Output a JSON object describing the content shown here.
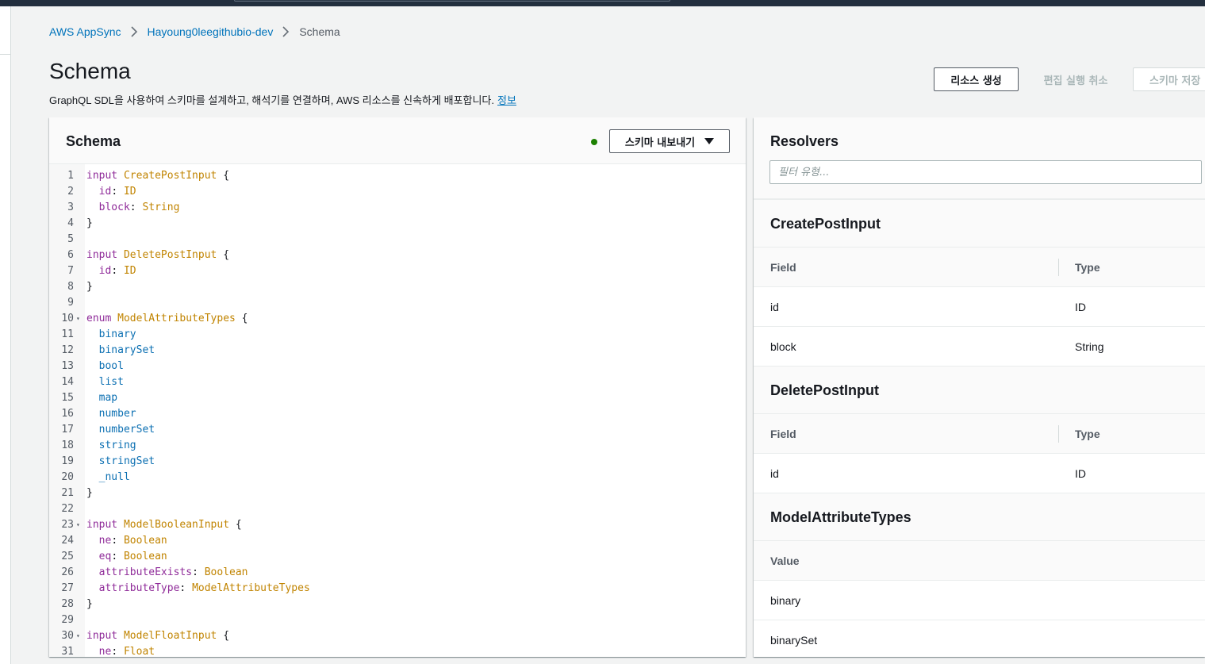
{
  "breadcrumb": {
    "items": [
      "AWS AppSync",
      "Hayoung0leegithubio-dev"
    ],
    "current": "Schema"
  },
  "page": {
    "title": "Schema",
    "description": "GraphQL SDL을 사용하여 스키마를 설계하고, 해석기를 연결하며, AWS 리소스를 신속하게 배포합니다.",
    "info_link": "정보"
  },
  "actions": {
    "create_resources": "리소스 생성",
    "cancel_edit": "편집 실행 취소",
    "save_schema": "스키마 저장"
  },
  "schema_panel": {
    "title": "Schema",
    "export_label": "스키마 내보내기",
    "status_color": "#1d8102",
    "lines": [
      {
        "n": "1",
        "fold": false,
        "tokens": [
          [
            "kw",
            "input"
          ],
          [
            "pn",
            " "
          ],
          [
            "tp",
            "CreatePostInput"
          ],
          [
            "pn",
            " {"
          ]
        ]
      },
      {
        "n": "2",
        "fold": false,
        "tokens": [
          [
            "pn",
            "  "
          ],
          [
            "fd",
            "id"
          ],
          [
            "pn",
            ": "
          ],
          [
            "tp",
            "ID"
          ]
        ]
      },
      {
        "n": "3",
        "fold": false,
        "tokens": [
          [
            "pn",
            "  "
          ],
          [
            "fd",
            "block"
          ],
          [
            "pn",
            ": "
          ],
          [
            "tp",
            "String"
          ]
        ]
      },
      {
        "n": "4",
        "fold": false,
        "tokens": [
          [
            "pn",
            "}"
          ]
        ]
      },
      {
        "n": "5",
        "fold": false,
        "tokens": []
      },
      {
        "n": "6",
        "fold": false,
        "tokens": [
          [
            "kw",
            "input"
          ],
          [
            "pn",
            " "
          ],
          [
            "tp",
            "DeletePostInput"
          ],
          [
            "pn",
            " {"
          ]
        ]
      },
      {
        "n": "7",
        "fold": false,
        "tokens": [
          [
            "pn",
            "  "
          ],
          [
            "fd",
            "id"
          ],
          [
            "pn",
            ": "
          ],
          [
            "tp",
            "ID"
          ]
        ]
      },
      {
        "n": "8",
        "fold": false,
        "tokens": [
          [
            "pn",
            "}"
          ]
        ]
      },
      {
        "n": "9",
        "fold": false,
        "tokens": []
      },
      {
        "n": "10",
        "fold": true,
        "tokens": [
          [
            "kw",
            "enum"
          ],
          [
            "pn",
            " "
          ],
          [
            "tp",
            "ModelAttributeTypes"
          ],
          [
            "pn",
            " {"
          ]
        ]
      },
      {
        "n": "11",
        "fold": false,
        "tokens": [
          [
            "pn",
            "  "
          ],
          [
            "ev",
            "binary"
          ]
        ]
      },
      {
        "n": "12",
        "fold": false,
        "tokens": [
          [
            "pn",
            "  "
          ],
          [
            "ev",
            "binarySet"
          ]
        ]
      },
      {
        "n": "13",
        "fold": false,
        "tokens": [
          [
            "pn",
            "  "
          ],
          [
            "ev",
            "bool"
          ]
        ]
      },
      {
        "n": "14",
        "fold": false,
        "tokens": [
          [
            "pn",
            "  "
          ],
          [
            "ev",
            "list"
          ]
        ]
      },
      {
        "n": "15",
        "fold": false,
        "tokens": [
          [
            "pn",
            "  "
          ],
          [
            "ev",
            "map"
          ]
        ]
      },
      {
        "n": "16",
        "fold": false,
        "tokens": [
          [
            "pn",
            "  "
          ],
          [
            "ev",
            "number"
          ]
        ]
      },
      {
        "n": "17",
        "fold": false,
        "tokens": [
          [
            "pn",
            "  "
          ],
          [
            "ev",
            "numberSet"
          ]
        ]
      },
      {
        "n": "18",
        "fold": false,
        "tokens": [
          [
            "pn",
            "  "
          ],
          [
            "ev",
            "string"
          ]
        ]
      },
      {
        "n": "19",
        "fold": false,
        "tokens": [
          [
            "pn",
            "  "
          ],
          [
            "ev",
            "stringSet"
          ]
        ]
      },
      {
        "n": "20",
        "fold": false,
        "tokens": [
          [
            "pn",
            "  "
          ],
          [
            "ev",
            "_null"
          ]
        ]
      },
      {
        "n": "21",
        "fold": false,
        "tokens": [
          [
            "pn",
            "}"
          ]
        ]
      },
      {
        "n": "22",
        "fold": false,
        "tokens": []
      },
      {
        "n": "23",
        "fold": true,
        "tokens": [
          [
            "kw",
            "input"
          ],
          [
            "pn",
            " "
          ],
          [
            "tp",
            "ModelBooleanInput"
          ],
          [
            "pn",
            " {"
          ]
        ]
      },
      {
        "n": "24",
        "fold": false,
        "tokens": [
          [
            "pn",
            "  "
          ],
          [
            "fd",
            "ne"
          ],
          [
            "pn",
            ": "
          ],
          [
            "tp",
            "Boolean"
          ]
        ]
      },
      {
        "n": "25",
        "fold": false,
        "tokens": [
          [
            "pn",
            "  "
          ],
          [
            "fd",
            "eq"
          ],
          [
            "pn",
            ": "
          ],
          [
            "tp",
            "Boolean"
          ]
        ]
      },
      {
        "n": "26",
        "fold": false,
        "tokens": [
          [
            "pn",
            "  "
          ],
          [
            "fd",
            "attributeExists"
          ],
          [
            "pn",
            ": "
          ],
          [
            "tp",
            "Boolean"
          ]
        ]
      },
      {
        "n": "27",
        "fold": false,
        "tokens": [
          [
            "pn",
            "  "
          ],
          [
            "fd",
            "attributeType"
          ],
          [
            "pn",
            ": "
          ],
          [
            "tp",
            "ModelAttributeTypes"
          ]
        ]
      },
      {
        "n": "28",
        "fold": false,
        "tokens": [
          [
            "pn",
            "}"
          ]
        ]
      },
      {
        "n": "29",
        "fold": false,
        "tokens": []
      },
      {
        "n": "30",
        "fold": true,
        "tokens": [
          [
            "kw",
            "input"
          ],
          [
            "pn",
            " "
          ],
          [
            "tp",
            "ModelFloatInput"
          ],
          [
            "pn",
            " {"
          ]
        ]
      },
      {
        "n": "31",
        "fold": false,
        "tokens": [
          [
            "pn",
            "  "
          ],
          [
            "fd",
            "ne"
          ],
          [
            "pn",
            ": "
          ],
          [
            "tp",
            "Float"
          ]
        ]
      }
    ]
  },
  "resolvers_panel": {
    "title": "Resolvers",
    "filter_placeholder": "필터 유형...",
    "sections": [
      {
        "name": "CreatePostInput",
        "columns": [
          "Field",
          "Type"
        ],
        "rows": [
          [
            "id",
            "ID"
          ],
          [
            "block",
            "String"
          ]
        ]
      },
      {
        "name": "DeletePostInput",
        "columns": [
          "Field",
          "Type"
        ],
        "rows": [
          [
            "id",
            "ID"
          ]
        ]
      },
      {
        "name": "ModelAttributeTypes",
        "columns": [
          "Value"
        ],
        "rows": [
          [
            "binary"
          ],
          [
            "binarySet"
          ]
        ]
      }
    ]
  }
}
